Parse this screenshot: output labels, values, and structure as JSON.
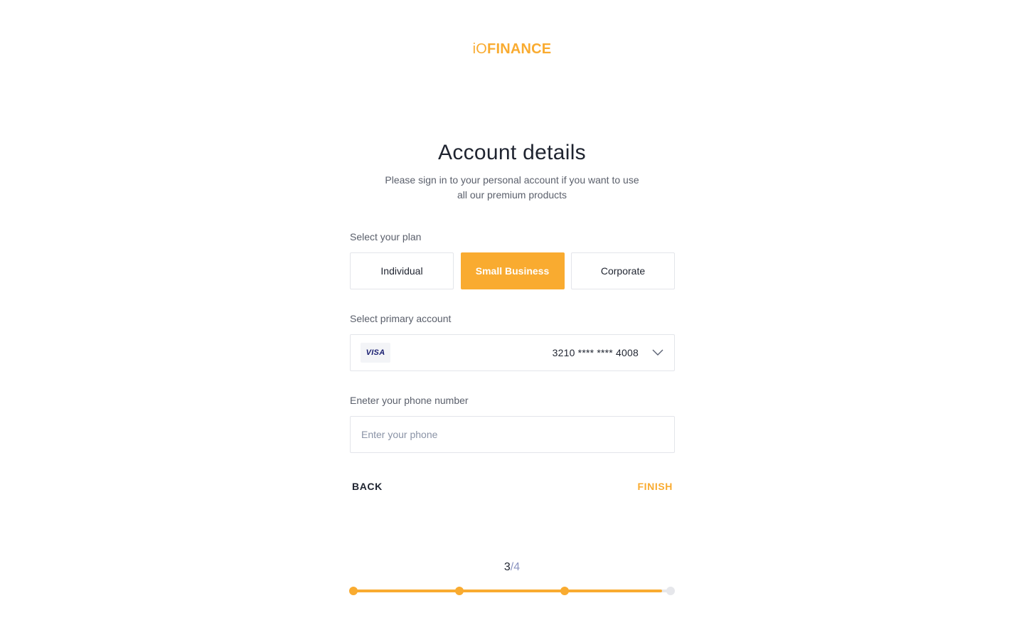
{
  "logo": {
    "prefix": "iO",
    "name": "FINANCE"
  },
  "header": {
    "title": "Account details",
    "subtitle": "Please sign in to your personal account if you want to use all our premium products"
  },
  "plan": {
    "label": "Select your plan",
    "options": [
      "Individual",
      "Small Business",
      "Corporate"
    ],
    "selected": "Small Business"
  },
  "account": {
    "label": "Select primary account",
    "card_brand": "VISA",
    "card_number": "3210 **** **** 4008",
    "icon": "chevron-down-icon"
  },
  "phone": {
    "label": "Eneter your phone number",
    "placeholder": "Enter your phone",
    "value": ""
  },
  "actions": {
    "back": "BACK",
    "finish": "FINISH"
  },
  "progress": {
    "current": "3",
    "separator": "/",
    "total": "4",
    "fraction": 0.97
  },
  "colors": {
    "accent": "#f9ab30",
    "text": "#1f2430",
    "muted": "#5a5f6b",
    "border": "#e3e5ea"
  }
}
